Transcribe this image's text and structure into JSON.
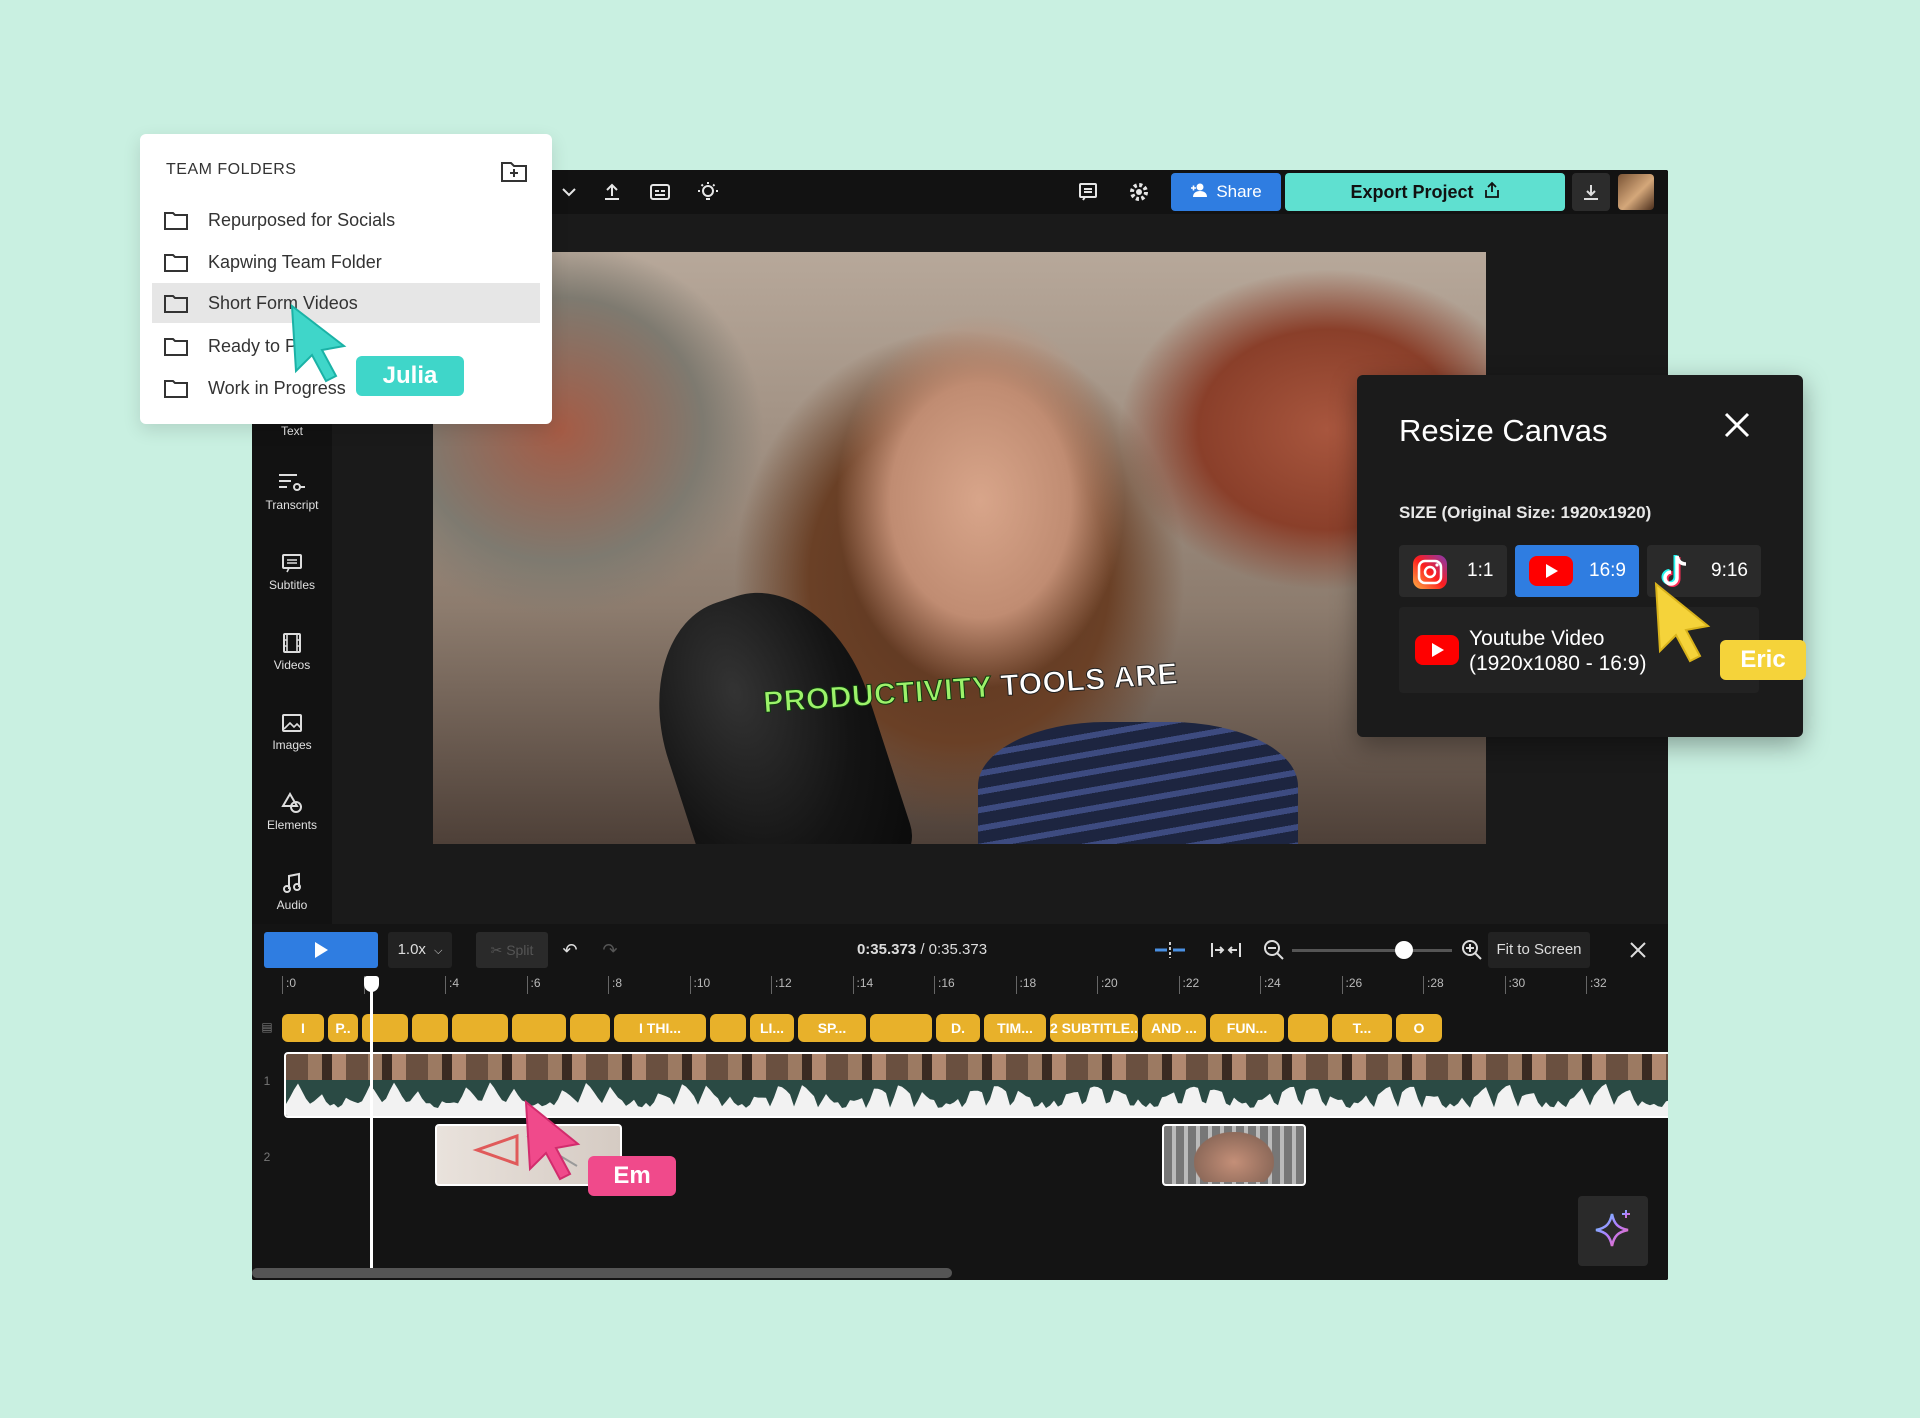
{
  "colors": {
    "background": "#c9f0e1",
    "accent_blue": "#2f7de1",
    "export_teal": "#5fe0d0",
    "subtitle_yellow": "#e8b12a",
    "cursor_julia": "#3fd6c9",
    "cursor_eric": "#f5d33a",
    "cursor_em": "#f04a8b"
  },
  "toolbar": {
    "share_label": "Share",
    "export_label": "Export Project",
    "icons": [
      "chevron-down-icon",
      "upload-icon",
      "captions-icon",
      "lightbulb-icon",
      "comment-icon",
      "gear-icon",
      "user-plus-icon",
      "download-icon"
    ]
  },
  "sidebar": {
    "items": [
      {
        "label": "Text",
        "icon": "text-icon"
      },
      {
        "label": "Transcript",
        "icon": "transcript-icon"
      },
      {
        "label": "Subtitles",
        "icon": "subtitles-icon"
      },
      {
        "label": "Videos",
        "icon": "film-icon"
      },
      {
        "label": "Images",
        "icon": "image-icon"
      },
      {
        "label": "Elements",
        "icon": "shapes-icon"
      },
      {
        "label": "Audio",
        "icon": "music-note-icon"
      }
    ]
  },
  "canvas": {
    "caption_highlight": "PRODUCTIVITY",
    "caption_rest": "TOOLS ARE"
  },
  "team_folders": {
    "title": "TEAM FOLDERS",
    "folders": [
      {
        "label": "Repurposed for Socials",
        "selected": false
      },
      {
        "label": "Kapwing Team Folder",
        "selected": false
      },
      {
        "label": "Short Form Videos",
        "selected": true
      },
      {
        "label": "Ready to P",
        "selected": false
      },
      {
        "label": "Work in Progress",
        "selected": false
      }
    ]
  },
  "collaborators": {
    "julia": "Julia",
    "eric": "Eric",
    "em": "Em"
  },
  "resize_canvas": {
    "title": "Resize Canvas",
    "size_label": "SIZE (Original Size: 1920x1920)",
    "options": [
      {
        "label": "1:1",
        "icon": "instagram-icon",
        "active": false
      },
      {
        "label": "16:9",
        "icon": "youtube-icon",
        "active": true
      },
      {
        "label": "9:16",
        "icon": "tiktok-icon",
        "active": false
      }
    ],
    "preset_line1": "Youtube Video",
    "preset_line2": "(1920x1080 - 16:9)"
  },
  "timeline": {
    "speed": "1.0x",
    "split_label": "Split",
    "time_current": "0:35.373",
    "time_separator": " / ",
    "time_total": "0:35.373",
    "fit_label": "Fit to Screen",
    "zoom_level": 0.7,
    "ruler_ticks": [
      ":0",
      ":2",
      ":4",
      ":6",
      ":8",
      ":10",
      ":12",
      ":14",
      ":16",
      ":18",
      ":20",
      ":22",
      ":24",
      ":26",
      ":28",
      ":30",
      ":32"
    ],
    "track_numbers": [
      "1",
      "2"
    ],
    "subtitle_segments": [
      "I",
      "P..",
      "",
      "",
      "",
      "",
      "",
      "I THI...",
      "",
      "LI...",
      "SP...",
      "",
      "D.",
      "TIM...",
      "2 SUBTITLE...",
      "AND ...",
      "FUN...",
      "",
      "T...",
      "O"
    ]
  }
}
